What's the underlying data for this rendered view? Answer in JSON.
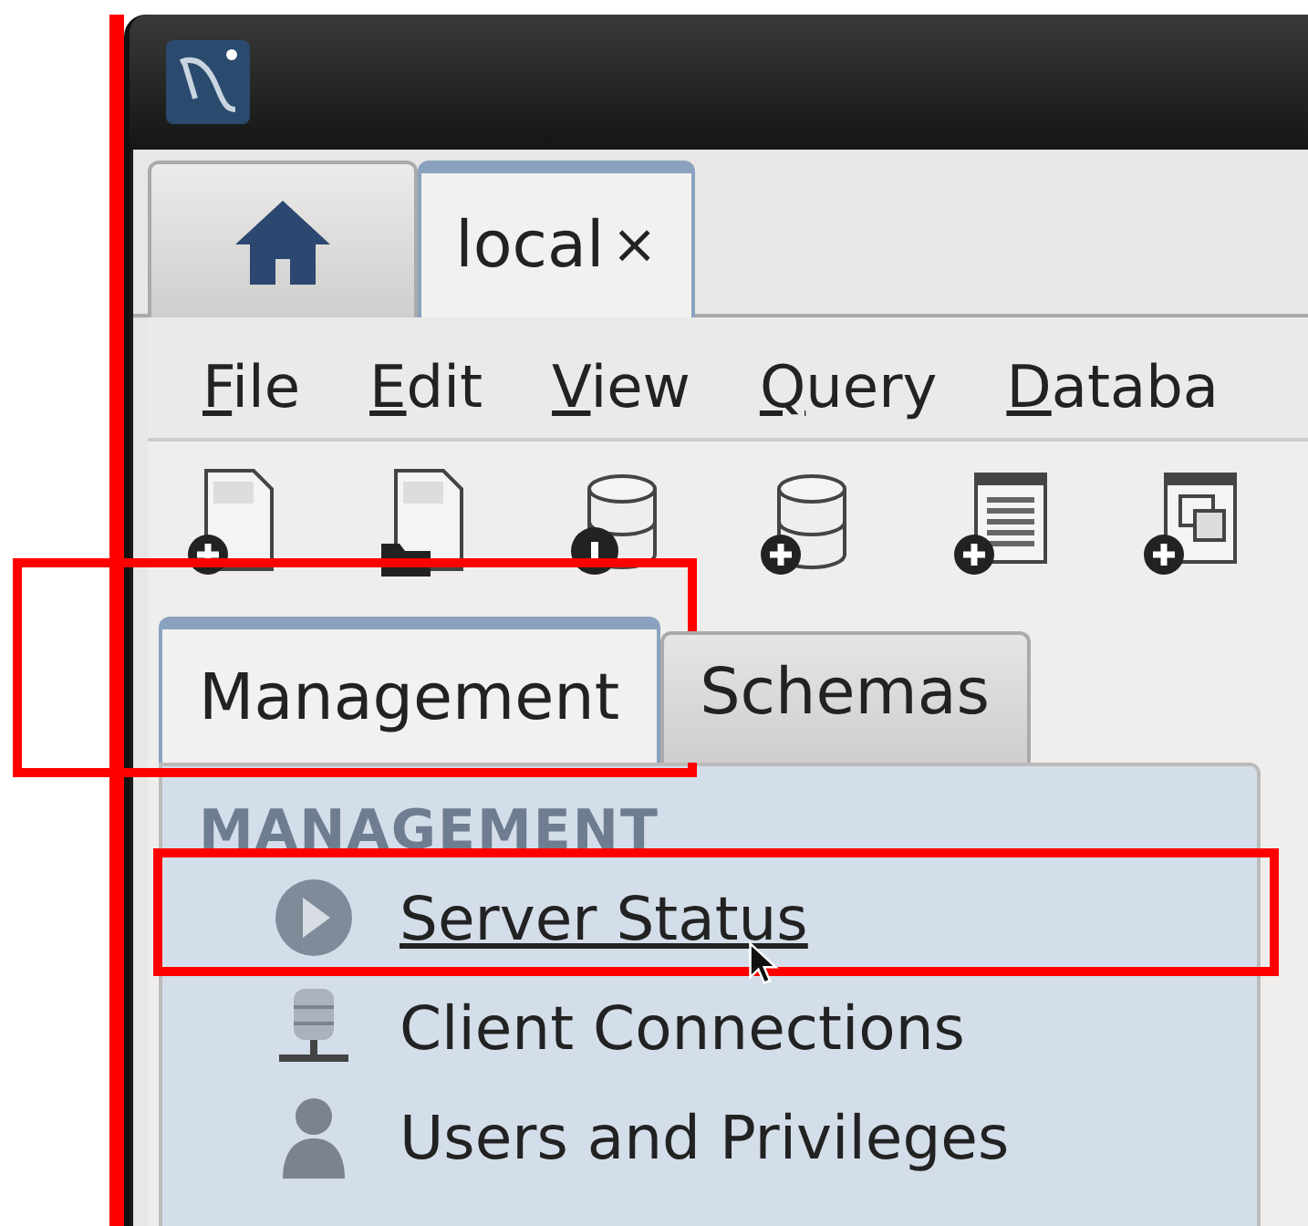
{
  "connection_tabs": [
    {
      "kind": "home",
      "selected": false
    },
    {
      "kind": "connection",
      "label": "local",
      "close": "×",
      "selected": true
    }
  ],
  "menu_bar": [
    "File",
    "Edit",
    "View",
    "Query",
    "Databa"
  ],
  "sidebar": {
    "tabs": [
      {
        "label": "Management",
        "selected": true,
        "highlighted": true
      },
      {
        "label": "Schemas",
        "selected": false,
        "highlighted": false
      }
    ],
    "section_title": "MANAGEMENT",
    "items": [
      {
        "kind": "status",
        "label": "Server Status",
        "hovered": true,
        "highlighted": true
      },
      {
        "kind": "connections",
        "label": "Client Connections",
        "hovered": false,
        "highlighted": false
      },
      {
        "kind": "users",
        "label": "Users and Privileges",
        "hovered": false,
        "highlighted": false
      }
    ]
  }
}
